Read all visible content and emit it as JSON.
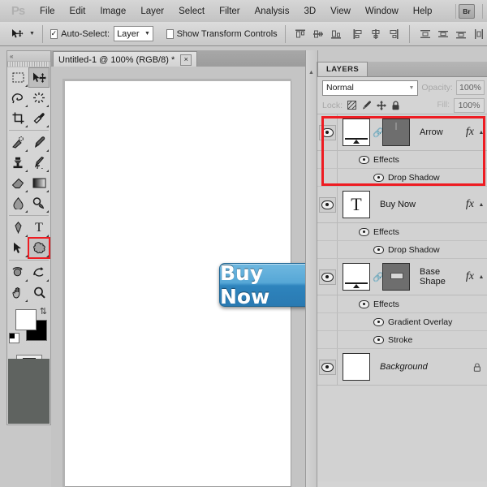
{
  "app": {
    "name": "Photoshop",
    "logo_text": "Ps"
  },
  "menubar": {
    "items": [
      {
        "label": "File"
      },
      {
        "label": "Edit"
      },
      {
        "label": "Image"
      },
      {
        "label": "Layer"
      },
      {
        "label": "Select"
      },
      {
        "label": "Filter"
      },
      {
        "label": "Analysis"
      },
      {
        "label": "3D"
      },
      {
        "label": "View"
      },
      {
        "label": "Window"
      },
      {
        "label": "Help"
      }
    ],
    "bridge_button": "Br"
  },
  "options_bar": {
    "tool_icon": "move-tool-icon",
    "auto_select_checked": "✓",
    "auto_select_label": "Auto-Select:",
    "auto_select_value": "Layer",
    "show_transform_checked": "",
    "show_transform_label": "Show Transform Controls",
    "align_icons": [
      "align-top-edges-icon",
      "align-vertical-centers-icon",
      "align-bottom-edges-icon",
      "align-left-edges-icon",
      "align-horizontal-centers-icon",
      "align-right-edges-icon",
      "distribute-top-edges-icon",
      "distribute-vertical-centers-icon",
      "distribute-bottom-edges-icon",
      "distribute-left-edges-icon"
    ]
  },
  "toolbar": {
    "tools": [
      {
        "name": "rectangular-marquee-tool",
        "has_submenu": true
      },
      {
        "name": "move-tool",
        "has_submenu": false,
        "selected": true
      },
      {
        "name": "lasso-tool",
        "has_submenu": true
      },
      {
        "name": "quick-selection-tool",
        "has_submenu": true
      },
      {
        "name": "crop-tool",
        "has_submenu": true
      },
      {
        "name": "eyedropper-tool",
        "has_submenu": true
      },
      {
        "name": "spot-healing-brush-tool",
        "has_submenu": true
      },
      {
        "name": "brush-tool",
        "has_submenu": true
      },
      {
        "name": "clone-stamp-tool",
        "has_submenu": true
      },
      {
        "name": "history-brush-tool",
        "has_submenu": true
      },
      {
        "name": "eraser-tool",
        "has_submenu": true
      },
      {
        "name": "gradient-tool",
        "has_submenu": true
      },
      {
        "name": "blur-tool",
        "has_submenu": true
      },
      {
        "name": "dodge-tool",
        "has_submenu": true
      },
      {
        "name": "pen-tool",
        "has_submenu": true
      },
      {
        "name": "horizontal-type-tool",
        "has_submenu": true
      },
      {
        "name": "path-selection-tool",
        "has_submenu": true
      },
      {
        "name": "custom-shape-tool",
        "has_submenu": true,
        "highlighted": true
      },
      {
        "name": "3d-object-rotate-tool",
        "has_submenu": true
      },
      {
        "name": "3d-camera-rotate-tool",
        "has_submenu": true
      },
      {
        "name": "hand-tool",
        "has_submenu": true
      },
      {
        "name": "zoom-tool",
        "has_submenu": false
      }
    ],
    "foreground_color": "#ffffff",
    "background_color": "#000000",
    "swap_icon": "swap-colors-icon",
    "default_colors_icon": "default-colors-icon",
    "quickmask_icon": "quick-mask-mode-icon"
  },
  "document": {
    "tab_title": "Untitled-1 @ 100% (RGB/8) *",
    "close_glyph": "×",
    "zoom": "100%",
    "color_mode": "RGB/8",
    "canvas_art": {
      "button_label": "Buy Now",
      "arrow_glyph": "❯",
      "button_color_top": "#6fb8e0",
      "button_color_bottom": "#2a7ab2"
    }
  },
  "layers_panel": {
    "tab_label": "LAYERS",
    "blend_mode": "Normal",
    "opacity_label": "Opacity:",
    "opacity_value": "100%",
    "lock_label": "Lock:",
    "lock_icons": [
      "lock-transparent-pixels-icon",
      "lock-image-pixels-icon",
      "lock-position-icon",
      "lock-all-icon"
    ],
    "fill_label": "Fill:",
    "fill_value": "100%",
    "highlight_color": "#ee1c22",
    "layers": [
      {
        "name": "Arrow",
        "visible": true,
        "thumb_type": "vector-mask",
        "linked": true,
        "has_fx": true,
        "fx_glyph": "fx",
        "expanded": true,
        "effects_label": "Effects",
        "effects": [
          "Drop Shadow"
        ],
        "highlighted": true
      },
      {
        "name": "Buy Now",
        "visible": true,
        "thumb_type": "text",
        "thumb_glyph": "T",
        "linked": false,
        "has_fx": true,
        "fx_glyph": "fx",
        "expanded": true,
        "effects_label": "Effects",
        "effects": [
          "Drop Shadow"
        ],
        "highlighted": false
      },
      {
        "name": "Base Shape",
        "visible": true,
        "thumb_type": "vector-mask",
        "linked": true,
        "has_fx": true,
        "fx_glyph": "fx",
        "expanded": true,
        "effects_label": "Effects",
        "effects": [
          "Gradient Overlay",
          "Stroke"
        ],
        "highlighted": false
      },
      {
        "name": "Background",
        "visible": true,
        "thumb_type": "plain",
        "linked": false,
        "has_fx": false,
        "locked": true,
        "italic": true,
        "expanded": false,
        "effects": [],
        "highlighted": false
      }
    ]
  }
}
